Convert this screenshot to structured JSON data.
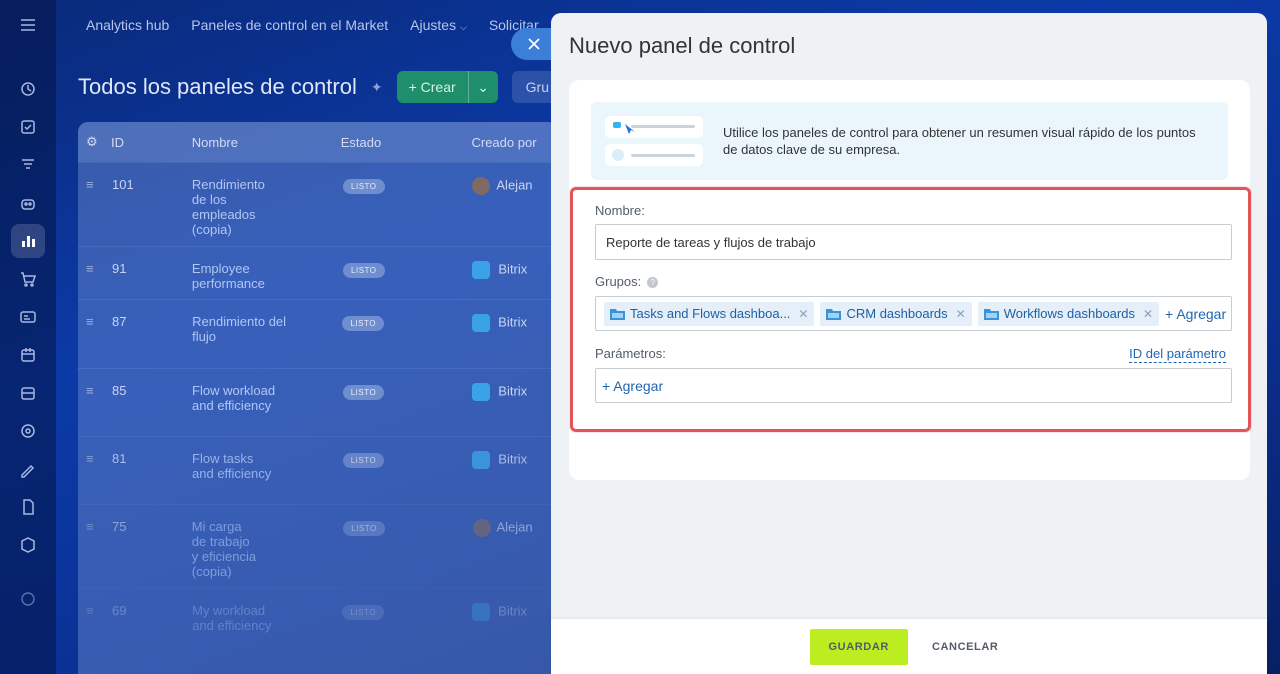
{
  "nav": {
    "items": [
      "Analytics hub",
      "Paneles de control en el Market",
      "Ajustes",
      "Solicitar"
    ]
  },
  "page": {
    "title": "Todos los paneles de control",
    "create_label": "+ Crear",
    "group_label": "Gru"
  },
  "grid": {
    "columns": [
      "ID",
      "Nombre",
      "Estado",
      "Creado por"
    ],
    "rows": [
      {
        "id": "101",
        "name": "Rendimiento de los empleados (copia)",
        "state": "LISTO",
        "by": "Alejan"
      },
      {
        "id": "91",
        "name": "Employee performance",
        "state": "LISTO",
        "by": "Bitrix"
      },
      {
        "id": "87",
        "name": "Rendimiento del flujo",
        "state": "LISTO",
        "by": "Bitrix"
      },
      {
        "id": "85",
        "name": "Flow workload and efficiency",
        "state": "LISTO",
        "by": "Bitrix"
      },
      {
        "id": "81",
        "name": "Flow tasks and efficiency",
        "state": "LISTO",
        "by": "Bitrix"
      },
      {
        "id": "75",
        "name": "Mi carga de trabajo y eficiencia (copia)",
        "state": "LISTO",
        "by": "Alejan"
      },
      {
        "id": "69",
        "name": "My workload and efficiency",
        "state": "LISTO",
        "by": "Bitrix"
      }
    ]
  },
  "panel": {
    "title": "Nuevo panel de control",
    "info_text": "Utilice los paneles de control para obtener un resumen visual rápido de los puntos de datos clave de su empresa.",
    "name_label": "Nombre:",
    "name_value": "Reporte de tareas y flujos de trabajo",
    "groups_label": "Grupos:",
    "groups": [
      "Tasks and Flows dashboa...",
      "CRM dashboards",
      "Workflows dashboards"
    ],
    "add_group": "+ Agregar",
    "params_label": "Parámetros:",
    "param_id_link": "ID del parámetro",
    "add_param": "+ Agregar",
    "save": "GUARDAR",
    "cancel": "CANCELAR"
  },
  "colors": {
    "accent": "#bbed21",
    "highlight": "#e3545a",
    "link": "#2066b0"
  }
}
